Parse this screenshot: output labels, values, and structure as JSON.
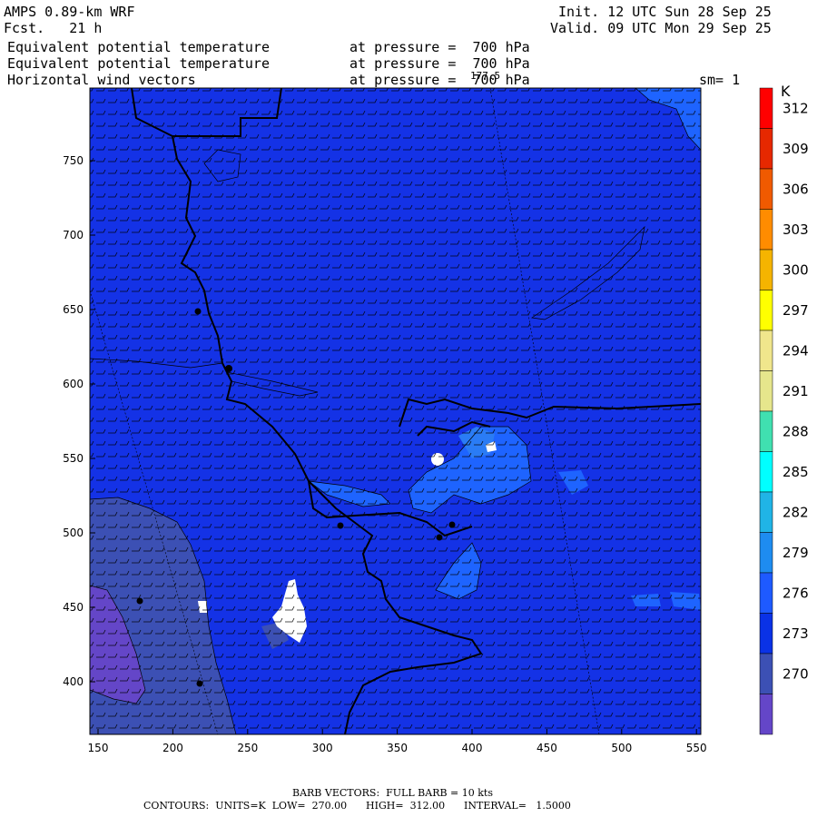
{
  "header": {
    "model": "AMPS 0.89-km WRF",
    "forecast": "Fcst.   21 h",
    "init": "Init. 12 UTC Sun 28 Sep 25",
    "valid": "Valid. 09 UTC Mon 29 Sep 25",
    "fields": [
      {
        "name": "Equivalent potential temperature",
        "level": "at pressure =  700 hPa"
      },
      {
        "name": "Equivalent potential temperature",
        "level": "at pressure =  700 hPa"
      },
      {
        "name": "Horizontal wind vectors",
        "level": "at pressure =  700 hPa"
      }
    ],
    "smoothing": "sm= 1",
    "max_label": "177.5"
  },
  "axes": {
    "x_ticks": [
      "150",
      "200",
      "250",
      "300",
      "350",
      "400",
      "450",
      "500",
      "550"
    ],
    "y_ticks": [
      "750",
      "700",
      "650",
      "600",
      "550",
      "500",
      "450",
      "400"
    ]
  },
  "colorbar": {
    "unit": "K",
    "labels": [
      "312",
      "309",
      "306",
      "303",
      "300",
      "297",
      "294",
      "291",
      "288",
      "285",
      "282",
      "279",
      "276",
      "273",
      "270"
    ],
    "colors": [
      "#ff0000",
      "#e62800",
      "#f05a00",
      "#ff8c00",
      "#f5b400",
      "#ffff00",
      "#f0e68c",
      "#e6e68c",
      "#40e0b0",
      "#00ffff",
      "#20b4e6",
      "#1e8cf0",
      "#1e5aff",
      "#0a32e6",
      "#3c50b4",
      "#6446c8"
    ]
  },
  "footer": {
    "barb": "BARB VECTORS:  FULL BARB = 10 kts",
    "contours": "CONTOURS:  UNITS=K  LOW=  270.00      HIGH=  312.00      INTERVAL=   1.5000"
  },
  "colors": {
    "field_main": "#1432e6",
    "field_low": "#3c50b4",
    "field_cold": "#6446c8",
    "field_warm": "#1e64ff"
  }
}
